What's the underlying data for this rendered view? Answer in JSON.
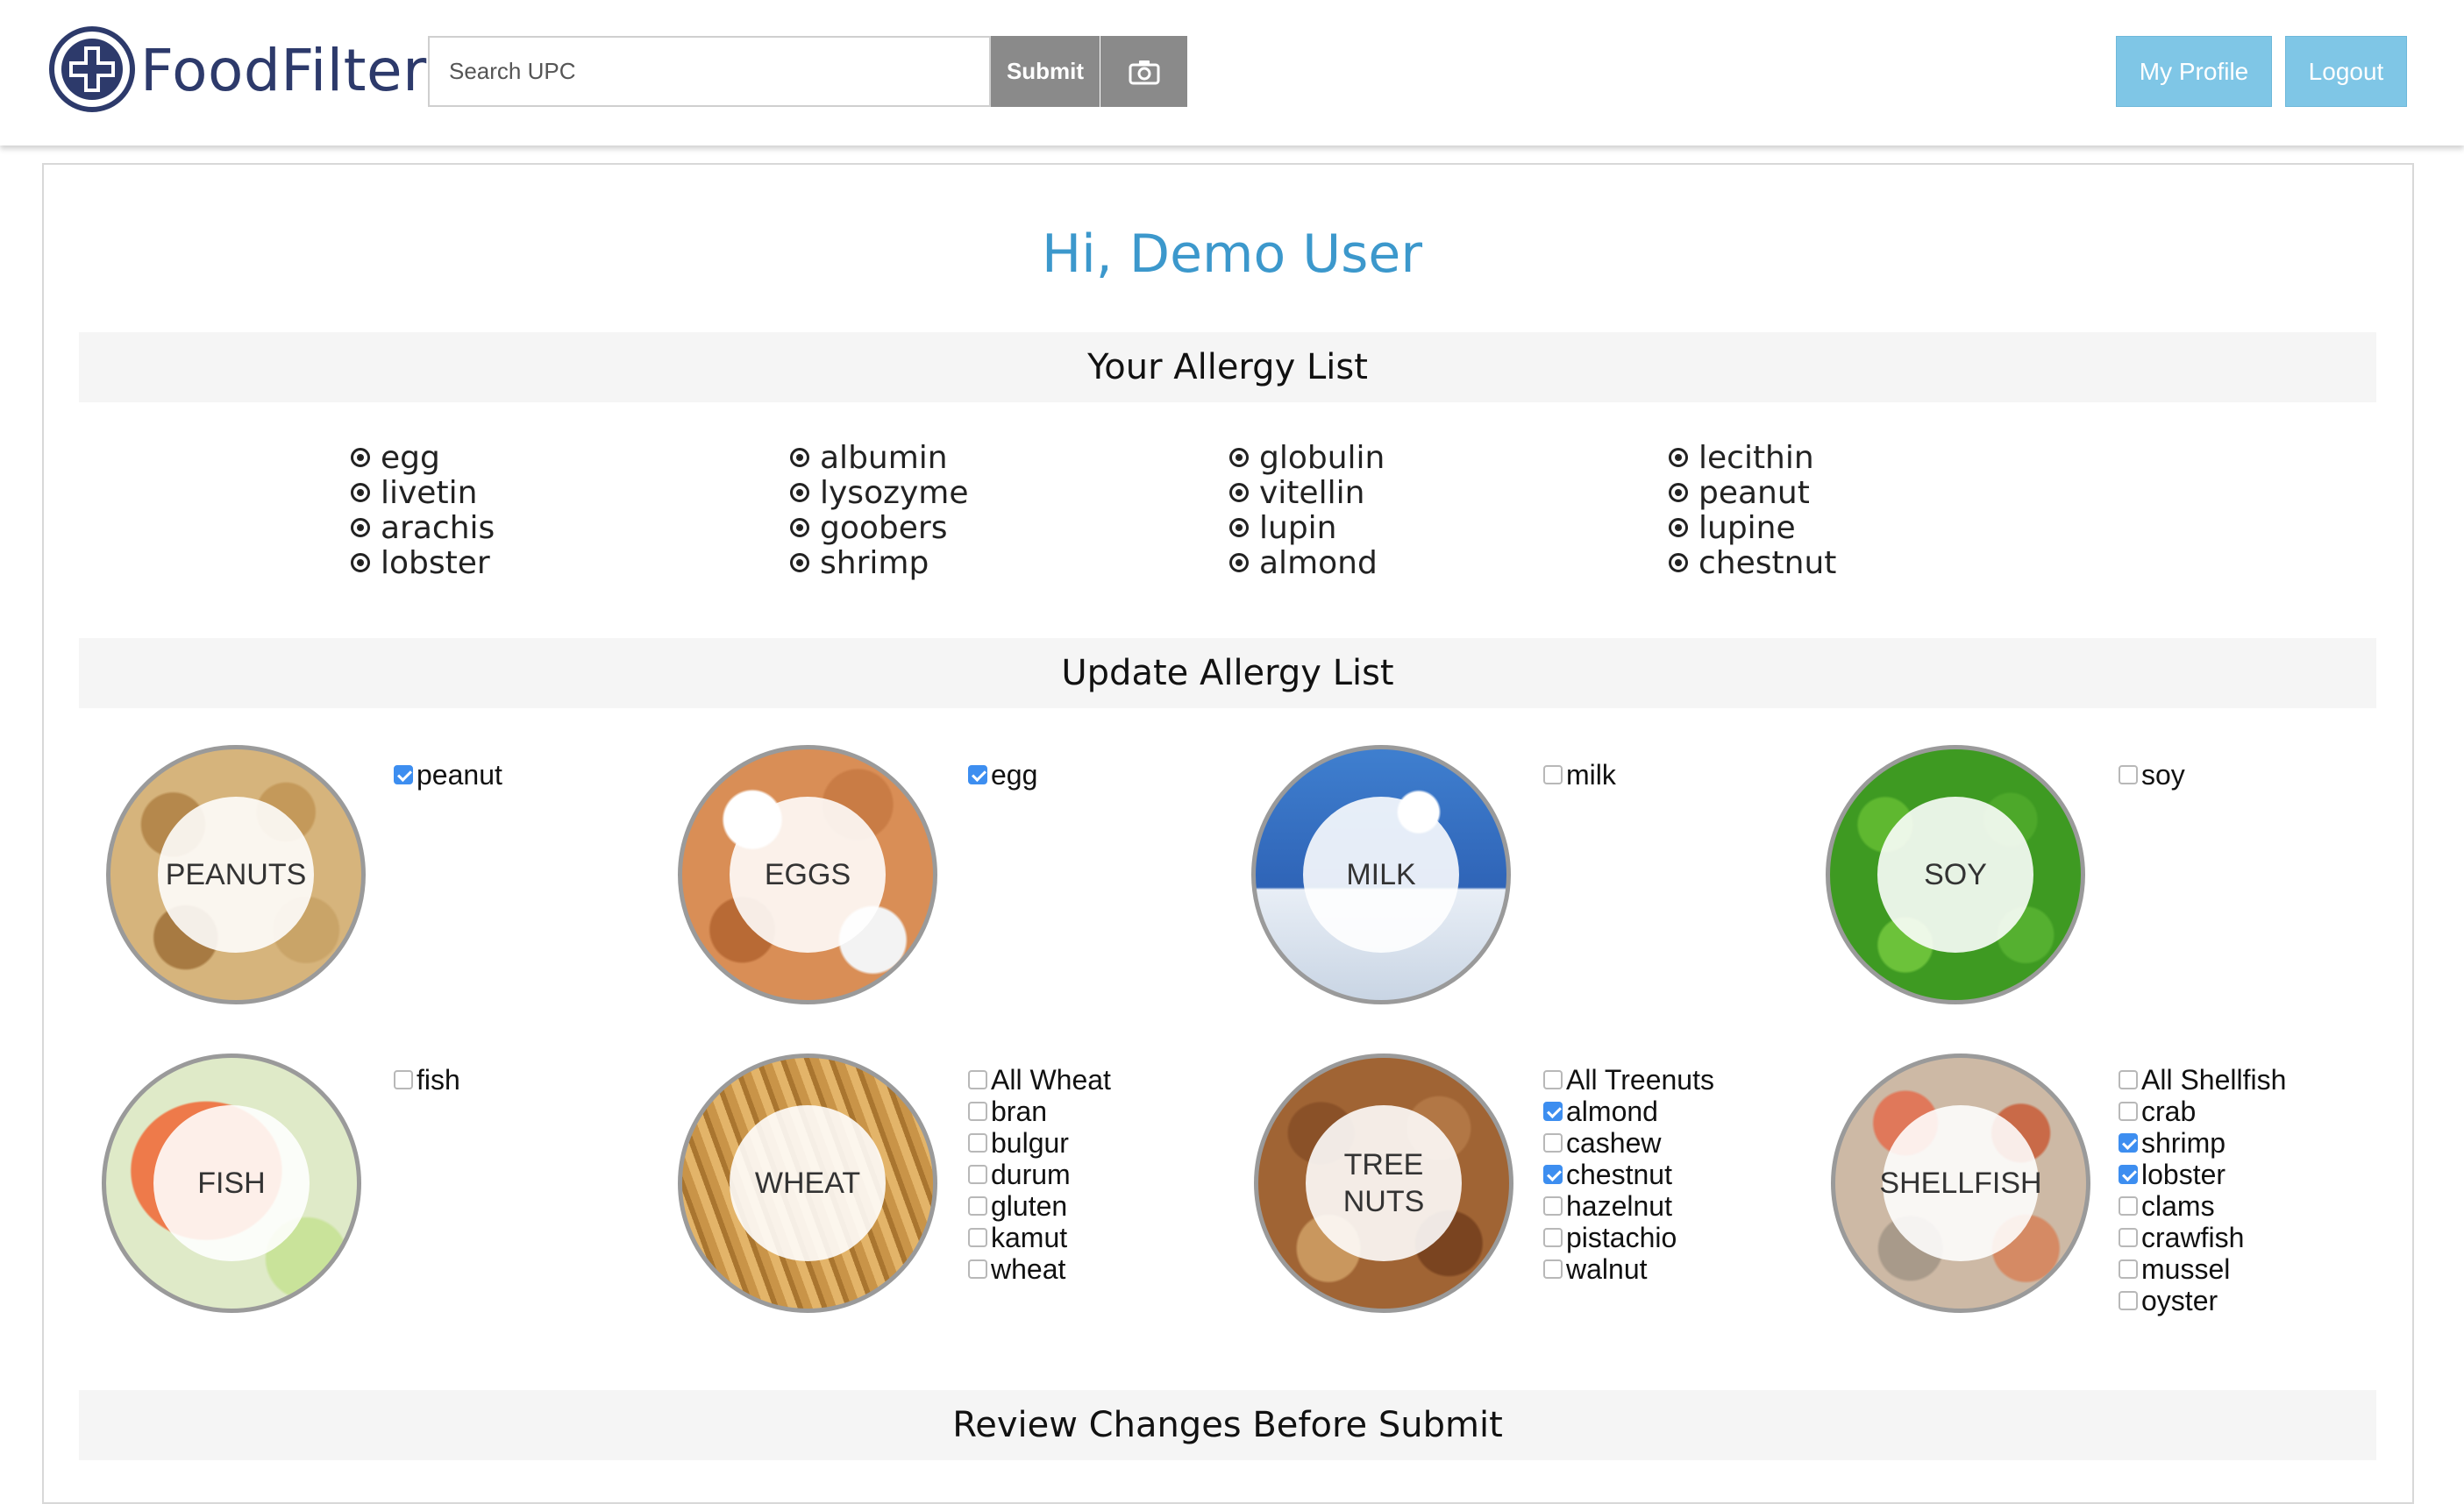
{
  "header": {
    "brand": "FoodFilter",
    "search_placeholder": "Search UPC",
    "submit_label": "Submit",
    "camera_icon": "camera-icon",
    "profile_label": "My Profile",
    "logout_label": "Logout"
  },
  "main": {
    "greeting": "Hi, Demo User",
    "allergy_list_title": "Your Allergy List",
    "allergy_columns": [
      [
        "egg",
        "livetin",
        "arachis",
        "lobster"
      ],
      [
        "albumin",
        "lysozyme",
        "goobers",
        "shrimp"
      ],
      [
        "globulin",
        "vitellin",
        "lupin",
        "almond"
      ],
      [
        "lecithin",
        "peanut",
        "lupine",
        "chestnut"
      ]
    ],
    "update_title": "Update Allergy List",
    "review_title": "Review Changes Before Submit",
    "categories": [
      {
        "label_lines": [
          "PEANUTS"
        ],
        "options": [
          {
            "label": "peanut",
            "checked": true
          }
        ]
      },
      {
        "label_lines": [
          "EGGS"
        ],
        "options": [
          {
            "label": "egg",
            "checked": true
          }
        ]
      },
      {
        "label_lines": [
          "MILK"
        ],
        "options": [
          {
            "label": "milk",
            "checked": false
          }
        ]
      },
      {
        "label_lines": [
          "SOY"
        ],
        "options": [
          {
            "label": "soy",
            "checked": false
          }
        ]
      },
      {
        "label_lines": [
          "FISH"
        ],
        "options": [
          {
            "label": "fish",
            "checked": false
          }
        ]
      },
      {
        "label_lines": [
          "WHEAT"
        ],
        "options": [
          {
            "label": "All Wheat",
            "checked": false
          },
          {
            "label": "bran",
            "checked": false
          },
          {
            "label": "bulgur",
            "checked": false
          },
          {
            "label": "durum",
            "checked": false
          },
          {
            "label": "gluten",
            "checked": false
          },
          {
            "label": "kamut",
            "checked": false
          },
          {
            "label": "wheat",
            "checked": false
          }
        ]
      },
      {
        "label_lines": [
          "TREE",
          "NUTS"
        ],
        "options": [
          {
            "label": "All Treenuts",
            "checked": false
          },
          {
            "label": "almond",
            "checked": true
          },
          {
            "label": "cashew",
            "checked": false
          },
          {
            "label": "chestnut",
            "checked": true
          },
          {
            "label": "hazelnut",
            "checked": false
          },
          {
            "label": "pistachio",
            "checked": false
          },
          {
            "label": "walnut",
            "checked": false
          }
        ]
      },
      {
        "label_lines": [
          "SHELLFISH"
        ],
        "options": [
          {
            "label": "All Shellfish",
            "checked": false
          },
          {
            "label": "crab",
            "checked": false
          },
          {
            "label": "shrimp",
            "checked": true
          },
          {
            "label": "lobster",
            "checked": true
          },
          {
            "label": "clams",
            "checked": false
          },
          {
            "label": "crawfish",
            "checked": false
          },
          {
            "label": "mussel",
            "checked": false
          },
          {
            "label": "oyster",
            "checked": false
          }
        ]
      }
    ]
  },
  "colors": {
    "accent": "#3c98cc",
    "brand": "#2d3a6b",
    "button_blue": "#7fc6e6",
    "button_grey": "#8a8a8a",
    "checkbox_checked": "#3d8ef0"
  }
}
